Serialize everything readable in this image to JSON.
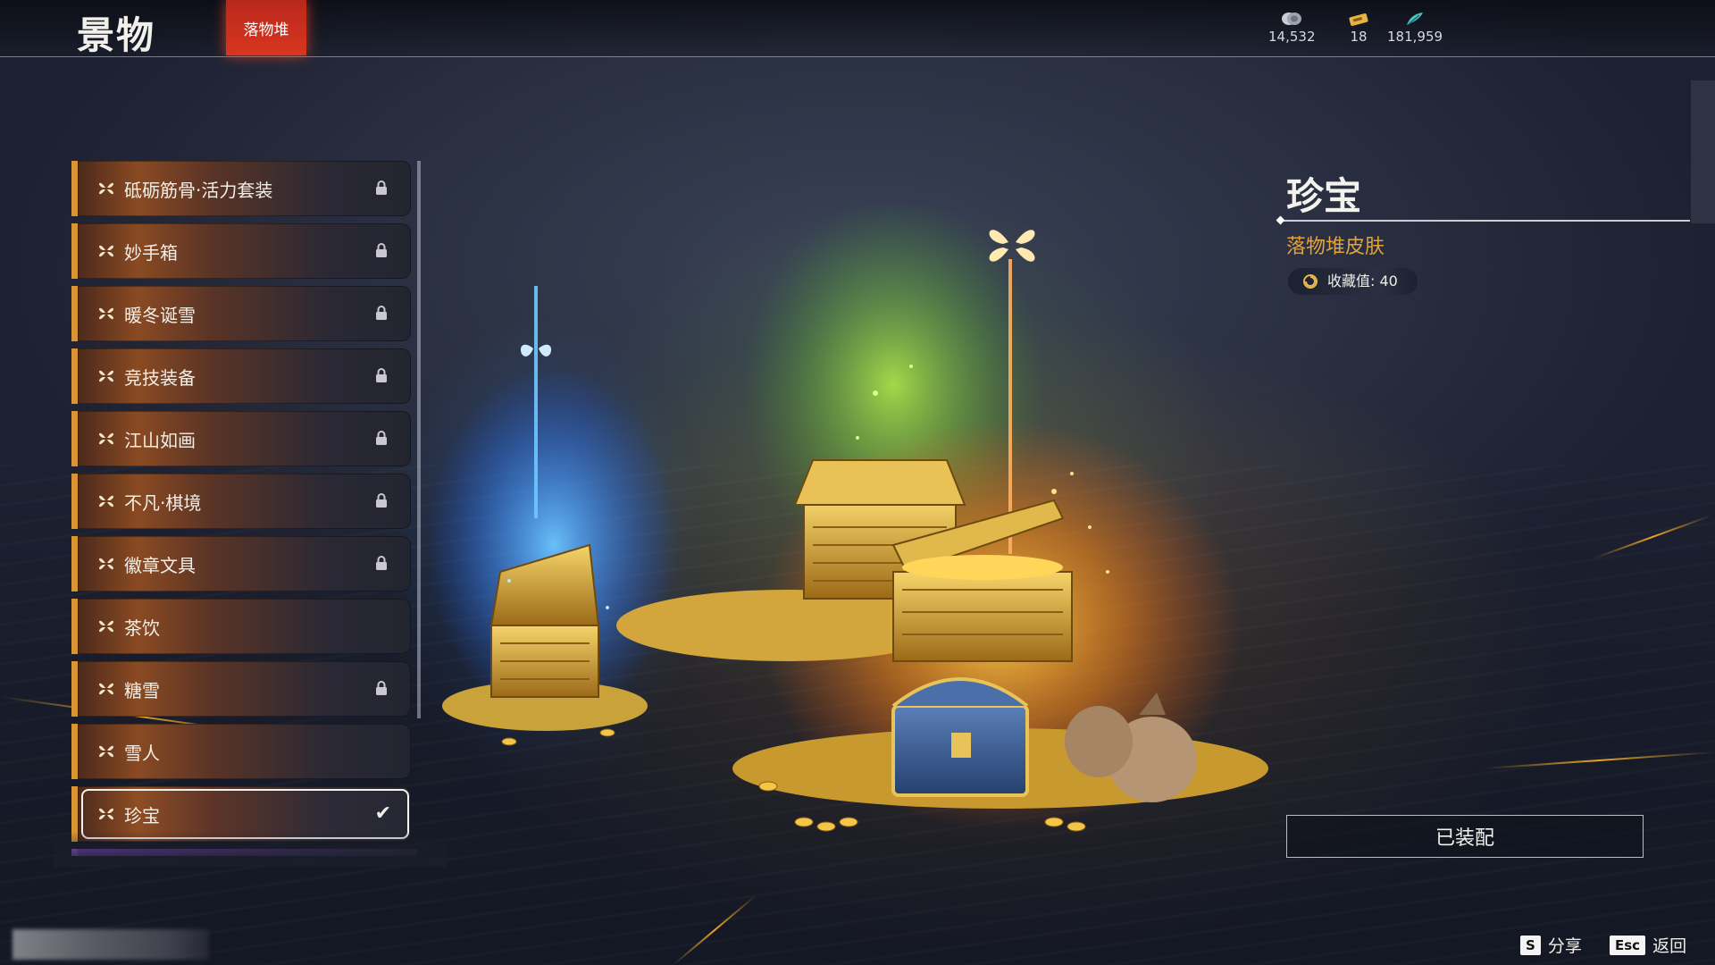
{
  "header": {
    "title": "景物",
    "active_tab": "落物堆",
    "currencies": [
      {
        "icon": "silver-coin-icon",
        "value": "14,532"
      },
      {
        "icon": "gold-ticket-icon",
        "value": "18"
      },
      {
        "icon": "feather-token-icon",
        "value": "181,959"
      }
    ]
  },
  "list": {
    "items": [
      {
        "name": "砥砺筋骨·活力套装",
        "state": "locked"
      },
      {
        "name": "妙手箱",
        "state": "locked"
      },
      {
        "name": "暖冬诞雪",
        "state": "locked"
      },
      {
        "name": "竞技装备",
        "state": "locked"
      },
      {
        "name": "江山如画",
        "state": "locked"
      },
      {
        "name": "不凡·棋境",
        "state": "locked"
      },
      {
        "name": "徽章文具",
        "state": "locked"
      },
      {
        "name": "茶饮",
        "state": "unlocked"
      },
      {
        "name": "糖雪",
        "state": "locked"
      },
      {
        "name": "雪人",
        "state": "unlocked"
      },
      {
        "name": "珍宝",
        "state": "equipped"
      }
    ]
  },
  "detail": {
    "name": "珍宝",
    "category": "落物堆皮肤",
    "collection_value": "收藏值: 40",
    "equip_label": "已装配"
  },
  "footer": {
    "share_key": "S",
    "share_label": "分享",
    "back_key": "Esc",
    "back_label": "返回"
  },
  "colors": {
    "accent_red": "#d8361f",
    "list_edge": "#d99535",
    "category_text": "#e3a23a"
  }
}
